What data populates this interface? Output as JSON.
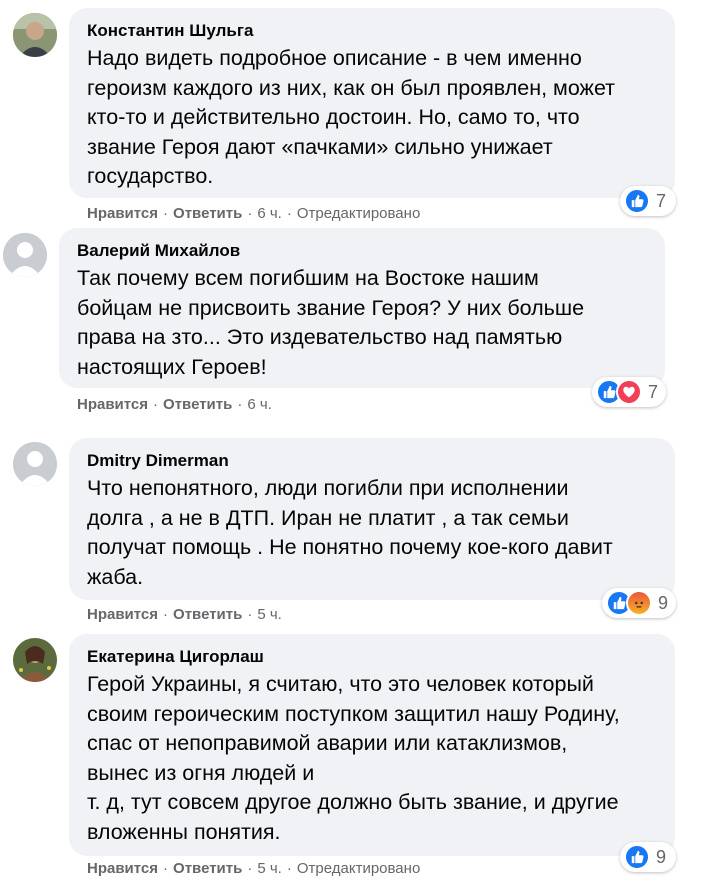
{
  "comments": [
    {
      "author": "Константин Шульга",
      "text": "Надо видеть подробное описание - в чем именно\nгероизм каждого из них, как он был проявлен, может\nкто-то и действительно достоин. Но, само то, что\nзвание Героя дают «пачками» сильно унижает\nгосударство.",
      "like_label": "Нравится",
      "reply_label": "Ответить",
      "time": "6 ч.",
      "edited": "Отредактировано",
      "reaction_count": "7",
      "reactions": [
        "like-icon"
      ]
    },
    {
      "author": "Валерий Михайлов",
      "text": "Так почему всем погибшим на Востоке нашим\nбойцам не присвоить звание Героя? У них больше\nправа на зто... Это издевательство над памятью\nнастоящих Героев!",
      "like_label": "Нравится",
      "reply_label": "Ответить",
      "time": "6 ч.",
      "reaction_count": "7",
      "reactions": [
        "like-icon",
        "love-icon"
      ]
    },
    {
      "author": "Dmitry Dimerman",
      "text": "Что непонятного, люди погибли при исполнении\nдолга , а не в ДТП. Иран не платит , а так семьи\nполучат помощь . Не понятно почему кое-кого давит\nжаба.",
      "like_label": "Нравится",
      "reply_label": "Ответить",
      "time": "5 ч.",
      "reaction_count": "9",
      "reactions": [
        "like-icon",
        "angry-icon"
      ]
    },
    {
      "author": "Екатерина Цигорлаш",
      "text": "Герой Украины, я считаю, что это человек который\nсвоим героическим поступком защитил нашу Родину,\nспас от непоправимой аварии или катаклизмов,\nвынес из огня людей и\nт. д, тут совсем другое должно быть звание, и другие\nвложенны понятия.",
      "like_label": "Нравится",
      "reply_label": "Ответить",
      "time": "5 ч.",
      "edited": "Отредактировано",
      "reaction_count": "9",
      "reactions": [
        "like-icon"
      ]
    }
  ],
  "colors": {
    "bubble": "#f0f2f5",
    "meta_text": "#65676b",
    "like": "#1877f2",
    "love": "#f33e58",
    "angry": "#f7b125"
  }
}
